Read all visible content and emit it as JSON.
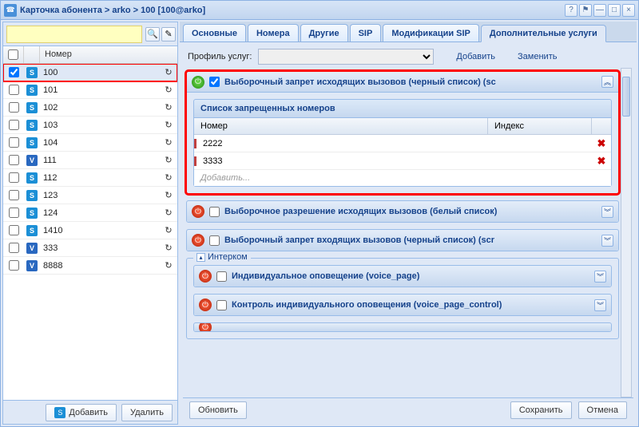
{
  "titlebar": {
    "text": "Карточка абонента > arko > 100 [100@arko]"
  },
  "left": {
    "header_col": "Номер",
    "add_btn": "Добавить",
    "del_btn": "Удалить",
    "rows": [
      {
        "num": "100",
        "type": "S",
        "checked": true,
        "selected": true
      },
      {
        "num": "101",
        "type": "S",
        "checked": false,
        "selected": false
      },
      {
        "num": "102",
        "type": "S",
        "checked": false,
        "selected": false
      },
      {
        "num": "103",
        "type": "S",
        "checked": false,
        "selected": false
      },
      {
        "num": "104",
        "type": "S",
        "checked": false,
        "selected": false
      },
      {
        "num": "111",
        "type": "V",
        "checked": false,
        "selected": false
      },
      {
        "num": "112",
        "type": "S",
        "checked": false,
        "selected": false
      },
      {
        "num": "123",
        "type": "S",
        "checked": false,
        "selected": false
      },
      {
        "num": "124",
        "type": "S",
        "checked": false,
        "selected": false
      },
      {
        "num": "1410",
        "type": "S",
        "checked": false,
        "selected": false
      },
      {
        "num": "333",
        "type": "V",
        "checked": false,
        "selected": false
      },
      {
        "num": "8888",
        "type": "V",
        "checked": false,
        "selected": false
      }
    ]
  },
  "tabs": {
    "items": [
      "Основные",
      "Номера",
      "Другие",
      "SIP",
      "Модификации SIP",
      "Дополнительные услуги"
    ],
    "active": 5
  },
  "profile": {
    "label": "Профиль услуг:",
    "add": "Добавить",
    "replace": "Заменить"
  },
  "svc": {
    "blacklist_out": {
      "title": "Выборочный запрет исходящих вызовов (черный список) (sc",
      "on": true,
      "checked": true,
      "inner_title": "Список запрещенных номеров",
      "col_num": "Номер",
      "col_idx": "Индекс",
      "rows": [
        {
          "num": "2222",
          "idx": ""
        },
        {
          "num": "3333",
          "idx": ""
        }
      ],
      "add_placeholder": "Добавить..."
    },
    "whitelist_out": {
      "title": "Выборочное разрешение исходящих вызовов (белый список)",
      "on": false
    },
    "blacklist_in": {
      "title": "Выборочный запрет входящих вызовов (черный список) (scr",
      "on": false
    },
    "intercom_legend": "Интерком",
    "voice_page": {
      "title": "Индивидуальное оповещение (voice_page)",
      "on": false
    },
    "voice_page_control": {
      "title": "Контроль индивидуального оповещения (voice_page_control)",
      "on": false
    }
  },
  "footer": {
    "refresh": "Обновить",
    "save": "Сохранить",
    "cancel": "Отмена"
  }
}
